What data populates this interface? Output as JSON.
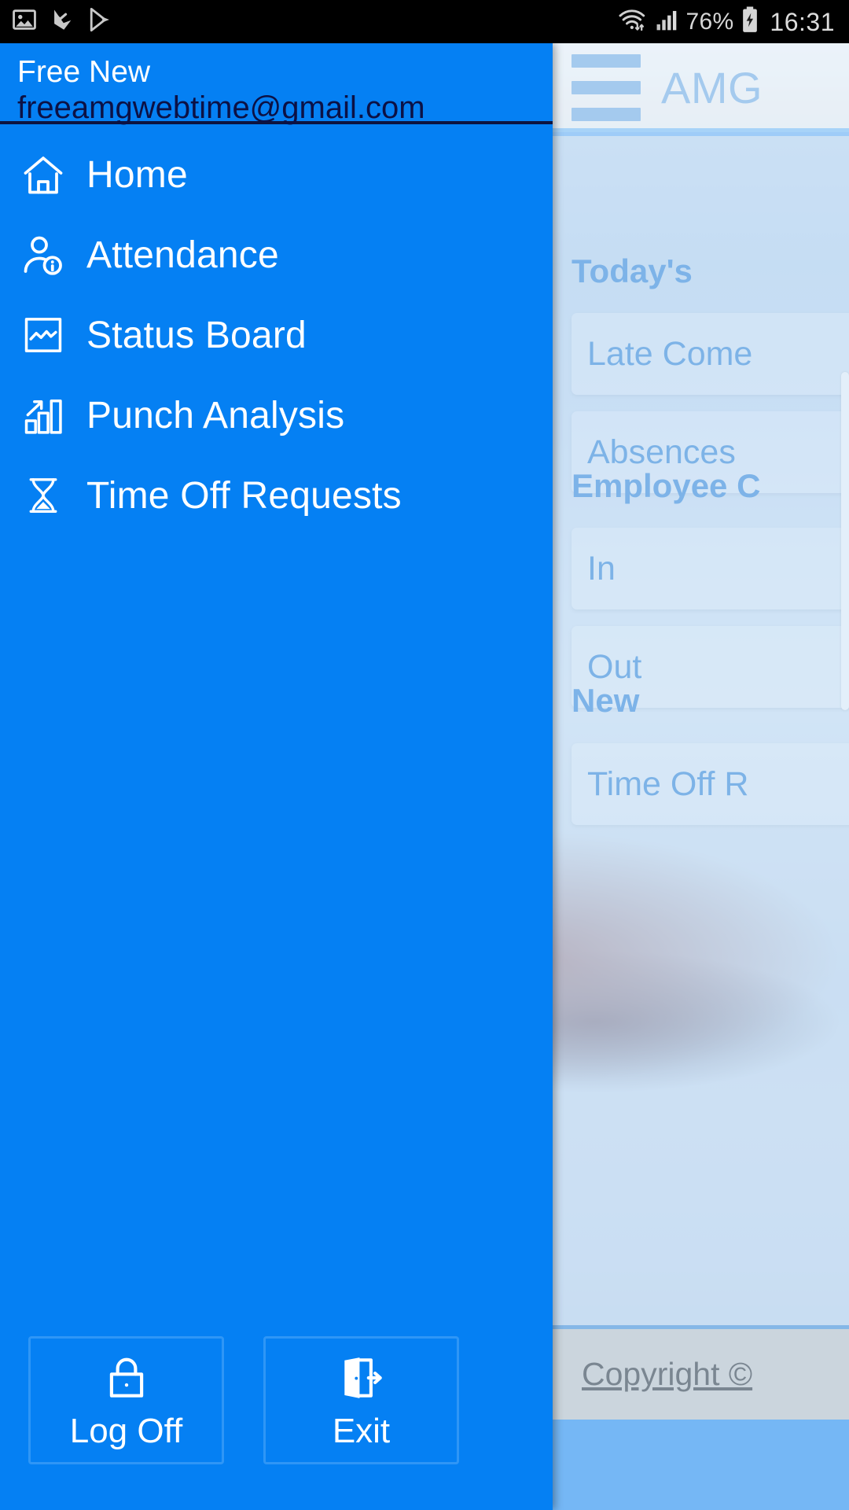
{
  "status_bar": {
    "left_icons": [
      "image-icon",
      "play-protect-icon",
      "play-store-icon"
    ],
    "right_icons": [
      "wifi-icon",
      "signal-icon",
      "battery-charging-icon"
    ],
    "battery_percent": "76%",
    "time": "16:31"
  },
  "drawer": {
    "account_name": "Free New",
    "account_email": "freeamgwebtime@gmail.com",
    "nav_items": [
      {
        "label": "Home",
        "icon": "home-icon"
      },
      {
        "label": "Attendance",
        "icon": "person-info-icon"
      },
      {
        "label": "Status Board",
        "icon": "chart-board-icon"
      },
      {
        "label": "Punch Analysis",
        "icon": "bar-chart-arrow-icon"
      },
      {
        "label": "Time Off Requests",
        "icon": "hourglass-icon"
      }
    ],
    "actions": [
      {
        "label": "Log Off",
        "icon": "lock-icon"
      },
      {
        "label": "Exit",
        "icon": "exit-door-icon"
      }
    ]
  },
  "background_app": {
    "app_bar": {
      "menu_icon": "hamburger-icon",
      "title": "AMG"
    },
    "sections": [
      {
        "title": "Today's",
        "cards": [
          "Late Come",
          "Absences"
        ]
      },
      {
        "title": "Employee C",
        "cards": [
          "In",
          "Out"
        ]
      },
      {
        "title": "New",
        "cards": [
          "Time Off R"
        ]
      }
    ],
    "footer_text": "Copyright ©"
  },
  "colors": {
    "drawer_blue": "#0580F3",
    "accent_blue": "#1878D4",
    "status_bar_bg": "#000000",
    "email_navy": "#0C1145",
    "button_border": "#2F96F6",
    "footer_bg": "#C8C3BD"
  }
}
